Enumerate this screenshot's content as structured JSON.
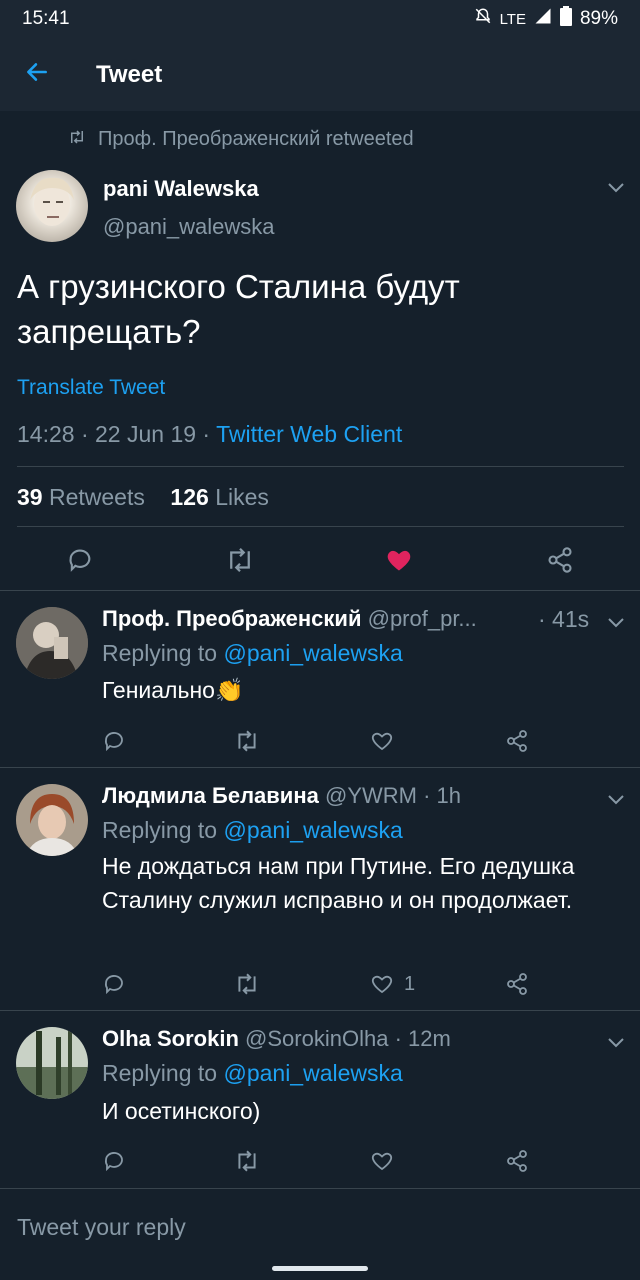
{
  "status_bar": {
    "time": "15:41",
    "network": "LTE",
    "battery": "89%"
  },
  "app_bar": {
    "title": "Tweet"
  },
  "main_tweet": {
    "retweeted_by": "Проф. Преображенский retweeted",
    "author_name": "pani Walewska",
    "author_handle": "@pani_walewska",
    "text": "А грузинского Сталина будут запрещать?",
    "translate": "Translate Tweet",
    "timestamp": "14:28 · 22 Jun 19 · ",
    "client": "Twitter Web Client",
    "retweets_count": "39",
    "retweets_label": "Retweets",
    "likes_count": "126",
    "likes_label": "Likes",
    "liked": true
  },
  "replies": [
    {
      "name": "Проф. Преображенский",
      "handle": "@prof_pr...",
      "time": "· 41s",
      "replying_prefix": "Replying to",
      "replying_to": "@pani_walewska",
      "text": "Гениально👏",
      "likes": ""
    },
    {
      "name": "Людмила Белавина",
      "handle": "@YWRM",
      "time": "· 1h",
      "replying_prefix": "Replying to",
      "replying_to": "@pani_walewska",
      "text": "Не дождаться нам при Путине. Его дедушка Сталину служил исправно  и он продолжает.",
      "likes": "1"
    },
    {
      "name": "Olha Sorokin",
      "handle": "@SorokinOlha",
      "time": "· 12m",
      "replying_prefix": "Replying to",
      "replying_to": "@pani_walewska",
      "text": "И осетинского)",
      "likes": ""
    }
  ],
  "composer": {
    "placeholder": "Tweet your reply"
  },
  "colors": {
    "background": "#15202b",
    "accent": "#1da1f2",
    "like": "#e0245e",
    "muted": "#8899a6"
  }
}
